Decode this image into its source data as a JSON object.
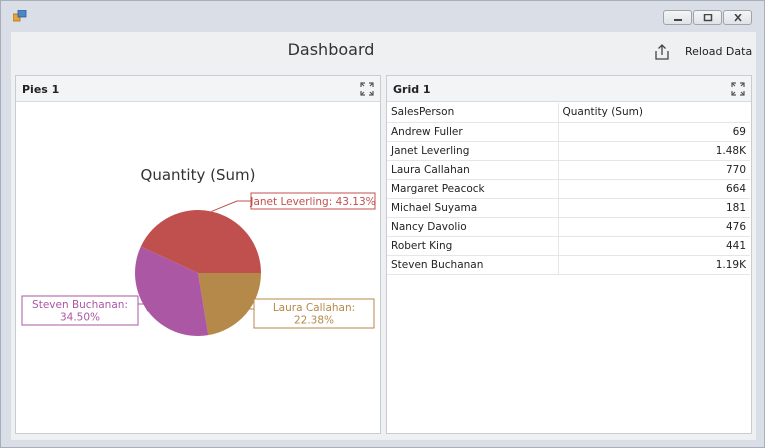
{
  "window": {
    "buttons": [
      "minimize",
      "maximize",
      "close"
    ]
  },
  "dashboard": {
    "title": "Dashboard",
    "export_icon": "export-icon",
    "reload_label": "Reload Data"
  },
  "pies": {
    "caption": "Pies 1",
    "maximize_icon": "maximize-icon"
  },
  "chart_data": {
    "type": "pie",
    "title": "Quantity (Sum)",
    "slices": [
      {
        "label": "Janet Leverling",
        "value": 43.13,
        "label_text": "Janet Leverling: 43.13%",
        "color": "#c0504d"
      },
      {
        "label": "Laura Callahan",
        "value": 22.38,
        "label_text": "Laura Callahan:\n22.38%",
        "color": "#b5894a"
      },
      {
        "label": "Steven Buchanan",
        "value": 34.5,
        "label_text": "Steven Buchanan:\n34.50%",
        "color": "#ab57a3"
      }
    ]
  },
  "grid": {
    "caption": "Grid 1",
    "maximize_icon": "maximize-icon",
    "columns": [
      "SalesPerson",
      "Quantity (Sum)"
    ],
    "rows": [
      [
        "Andrew Fuller",
        "69"
      ],
      [
        "Janet Leverling",
        "1.48K"
      ],
      [
        "Laura Callahan",
        "770"
      ],
      [
        "Margaret Peacock",
        "664"
      ],
      [
        "Michael Suyama",
        "181"
      ],
      [
        "Nancy Davolio",
        "476"
      ],
      [
        "Robert King",
        "441"
      ],
      [
        "Steven Buchanan",
        "1.19K"
      ]
    ]
  }
}
